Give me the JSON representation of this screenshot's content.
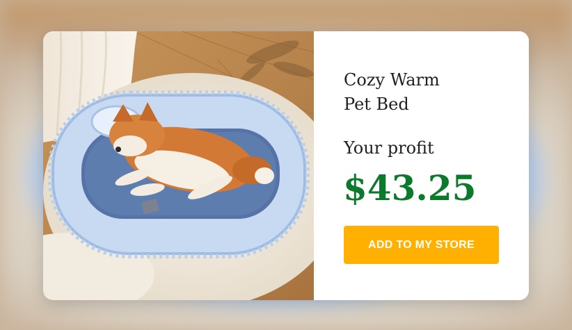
{
  "product": {
    "title": "Cozy Warm\nPet Bed",
    "profit_label": "Your profit",
    "profit_value": "$43.25",
    "image_alt": "Dog sleeping in a light blue pet bed"
  },
  "actions": {
    "add_to_store_label": "ADD TO MY STORE"
  },
  "colors": {
    "price": "#0b7a2a",
    "button": "#ffb000",
    "button_text": "#ffffff"
  }
}
